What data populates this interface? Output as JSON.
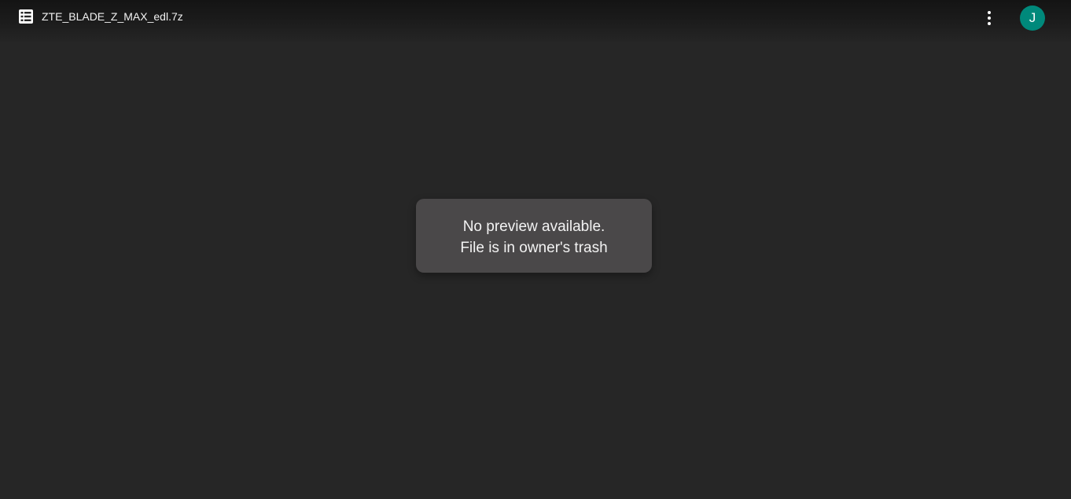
{
  "header": {
    "file_name": "ZTE_BLADE_Z_MAX_edl.7z",
    "file_icon": "file-list-icon",
    "more_icon": "more-vert-icon",
    "avatar_initial": "J"
  },
  "message": {
    "line1": "No preview available.",
    "line2": "File is in owner's trash"
  },
  "colors": {
    "background": "#262626",
    "topbar": "#141414",
    "card": "#4a4849",
    "avatar": "#00897b",
    "text": "#ffffff"
  }
}
